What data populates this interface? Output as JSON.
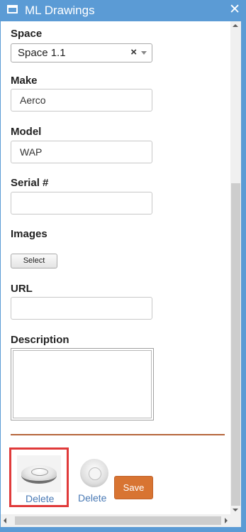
{
  "window": {
    "title": "ML Drawings",
    "close_glyph": "✕"
  },
  "form": {
    "space": {
      "label": "Space",
      "value": "Space 1.1",
      "clear_glyph": "×"
    },
    "make": {
      "label": "Make",
      "value": "Aerco"
    },
    "model": {
      "label": "Model",
      "value": "WAP"
    },
    "serial": {
      "label": "Serial #",
      "value": ""
    },
    "images": {
      "label": "Images",
      "select_label": "Select"
    },
    "url": {
      "label": "URL",
      "value": ""
    },
    "description": {
      "label": "Description",
      "value": ""
    }
  },
  "thumbnails": [
    {
      "icon": "smoke-detector-image",
      "delete_label": "Delete",
      "selected": true
    },
    {
      "icon": "smoke-detector-image",
      "delete_label": "Delete",
      "selected": false
    }
  ],
  "actions": {
    "save_label": "Save"
  },
  "colors": {
    "titlebar": "#5b9bd5",
    "divider": "#b5653a",
    "save_button": "#d87432",
    "link": "#4a7ab5",
    "selection_border": "#e03a3a"
  }
}
